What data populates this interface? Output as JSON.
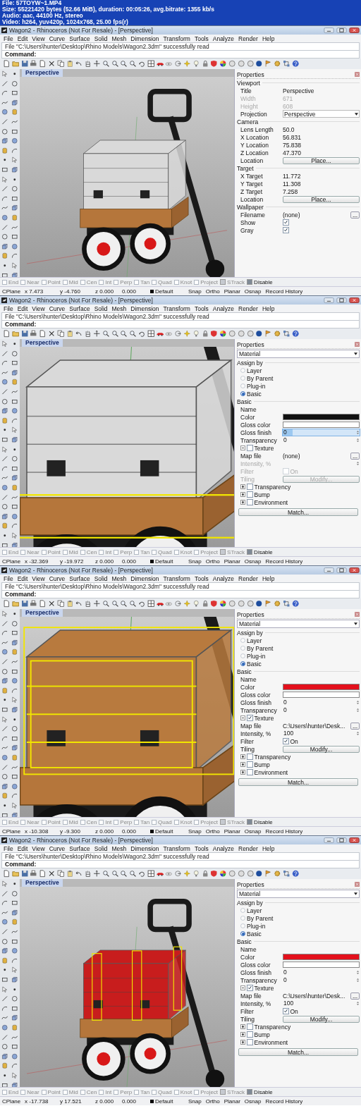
{
  "file_info": [
    "File: 57TOYW~1.MP4",
    "Size: 55221420 bytes (52.66 MiB), duration: 00:05:26, avg.bitrate: 1355 kb/s",
    "Audio: aac, 44100 Hz, stereo",
    "Video: h264, yuv420p, 1024x768, 25.00 fps(r)"
  ],
  "frames": [
    {
      "window_title": "Wagon2 - Rhinoceros (Not For Resale) - [Perspective]",
      "menu": [
        "File",
        "Edit",
        "View",
        "Curve",
        "Surface",
        "Solid",
        "Mesh",
        "Dimension",
        "Transform",
        "Tools",
        "Analyze",
        "Render",
        "Help"
      ],
      "history": "File \"C:\\Users\\hunter\\Desktop\\Rhino Models\\Wagon2.3dm\" successfully read",
      "command_label": "Command:",
      "viewport_title": "Perspective",
      "scene": {
        "kind": "overview"
      },
      "panel": {
        "title": "Properties",
        "sections": [
          {
            "heading": "Viewport",
            "rows": [
              {
                "kind": "field",
                "label": "Title",
                "value": "Perspective",
                "disabled": false
              },
              {
                "kind": "field",
                "label": "Width",
                "value": "671",
                "disabled": true
              },
              {
                "kind": "field",
                "label": "Height",
                "value": "608",
                "disabled": true
              },
              {
                "kind": "select",
                "label": "Projection",
                "value": "Perspective"
              }
            ]
          },
          {
            "heading": "Camera",
            "rows": [
              {
                "kind": "field",
                "label": "Lens Length",
                "value": "50.0",
                "disabled": false
              },
              {
                "kind": "field",
                "label": "X Location",
                "value": "56.831",
                "disabled": false
              },
              {
                "kind": "field",
                "label": "Y Location",
                "value": "75.838",
                "disabled": false
              },
              {
                "kind": "field",
                "label": "Z Location",
                "value": "47.370",
                "disabled": false
              },
              {
                "kind": "button",
                "label": "Location",
                "button": "Place...",
                "disabled": false
              }
            ]
          },
          {
            "heading": "Target",
            "rows": [
              {
                "kind": "field",
                "label": "X Target",
                "value": "11.772",
                "disabled": false
              },
              {
                "kind": "field",
                "label": "Y Target",
                "value": "11.308",
                "disabled": false
              },
              {
                "kind": "field",
                "label": "Z Target",
                "value": "7.258",
                "disabled": false
              },
              {
                "kind": "button",
                "label": "Location",
                "button": "Place...",
                "disabled": false
              }
            ]
          },
          {
            "heading": "Wallpaper",
            "rows": [
              {
                "kind": "browse",
                "label": "Filename",
                "value": "(none)",
                "button": "..."
              },
              {
                "kind": "check",
                "label": "Show",
                "checked": true,
                "disabled": false
              },
              {
                "kind": "check",
                "label": "Gray",
                "checked": true,
                "disabled": false
              }
            ]
          }
        ]
      },
      "osnaps": [
        {
          "kind": "check",
          "label": "End",
          "checked": false
        },
        {
          "kind": "check",
          "label": "Near",
          "checked": false
        },
        {
          "kind": "check",
          "label": "Point",
          "checked": false
        },
        {
          "kind": "check",
          "label": "Mid",
          "checked": false
        },
        {
          "kind": "check",
          "label": "Cen",
          "checked": false
        },
        {
          "kind": "check",
          "label": "Int",
          "checked": false
        },
        {
          "kind": "check",
          "label": "Perp",
          "checked": false
        },
        {
          "kind": "check",
          "label": "Tan",
          "checked": false
        },
        {
          "kind": "check",
          "label": "Quad",
          "checked": false
        },
        {
          "kind": "check",
          "label": "Knot",
          "checked": false
        },
        {
          "kind": "check",
          "label": "Project",
          "checked": false
        },
        {
          "kind": "toggle",
          "label": "STrack",
          "checked": false
        },
        {
          "kind": "toggle",
          "label": "Disable",
          "checked": true
        }
      ],
      "status": {
        "cplane": "CPlane",
        "x": "x 7.473",
        "y": "y -4.760",
        "z": "z 0.000",
        "value": "0.000",
        "layer": "Default",
        "panes": [
          "Snap",
          "Ortho",
          "Planar",
          "Osnap",
          "Record History"
        ]
      }
    },
    {
      "window_title": "Wagon2 - Rhinoceros (Not For Resale) - [Perspective]",
      "menu": [
        "File",
        "Edit",
        "View",
        "Curve",
        "Surface",
        "Solid",
        "Mesh",
        "Dimension",
        "Transform",
        "Tools",
        "Analyze",
        "Render",
        "Help"
      ],
      "history": "File \"C:\\Users\\hunter\\Desktop\\Rhino Models\\Wagon2.3dm\" successfully read",
      "command_label": "Command:",
      "viewport_title": "Perspective",
      "scene": {
        "kind": "base"
      },
      "panel": {
        "title": "Properties",
        "dropdown": "Material",
        "sections": [
          {
            "heading": "Assign by",
            "rows": [
              {
                "kind": "radio",
                "label": "Layer",
                "selected": false
              },
              {
                "kind": "radio",
                "label": "By Parent",
                "selected": false
              },
              {
                "kind": "radio",
                "label": "Plug-in",
                "selected": false
              },
              {
                "kind": "radio",
                "label": "Basic",
                "selected": true
              }
            ]
          },
          {
            "heading": "Basic",
            "rows": [
              {
                "kind": "field",
                "label": "Name",
                "disabled": false
              },
              {
                "kind": "swatch",
                "label": "Color",
                "color": "#111111"
              },
              {
                "kind": "swatch",
                "label": "Gloss color",
                "color": "#ffffff"
              },
              {
                "kind": "spin",
                "label": "Gloss finish",
                "value": "0",
                "disabled": false,
                "highlighted": true
              },
              {
                "kind": "spin",
                "label": "Transparency",
                "value": "0",
                "disabled": false,
                "highlighted": false
              },
              {
                "kind": "group",
                "label": "Texture",
                "checked": false,
                "expanded": true
              },
              {
                "kind": "browse",
                "label": "Map file",
                "value": "(none)",
                "button": "..."
              },
              {
                "kind": "spin",
                "label": "Intensity, %",
                "disabled": true,
                "highlighted": false
              },
              {
                "kind": "check",
                "label": "Filter",
                "text": "On",
                "checked": false,
                "disabled": true
              },
              {
                "kind": "button",
                "label": "Tiling",
                "button": "Modify...",
                "disabled": true
              },
              {
                "kind": "group",
                "label": "Transparency",
                "checked": false,
                "expanded": false
              },
              {
                "kind": "group",
                "label": "Bump",
                "checked": false,
                "expanded": false
              },
              {
                "kind": "group",
                "label": "Environment",
                "checked": false,
                "expanded": false
              }
            ]
          }
        ],
        "footer_button": "Match..."
      },
      "osnaps": [
        {
          "kind": "check",
          "label": "End",
          "checked": false
        },
        {
          "kind": "check",
          "label": "Near",
          "checked": false
        },
        {
          "kind": "check",
          "label": "Point",
          "checked": false
        },
        {
          "kind": "check",
          "label": "Mid",
          "checked": false
        },
        {
          "kind": "check",
          "label": "Cen",
          "checked": false
        },
        {
          "kind": "check",
          "label": "Int",
          "checked": false
        },
        {
          "kind": "check",
          "label": "Perp",
          "checked": false
        },
        {
          "kind": "check",
          "label": "Tan",
          "checked": false
        },
        {
          "kind": "check",
          "label": "Quad",
          "checked": false
        },
        {
          "kind": "check",
          "label": "Knot",
          "checked": false
        },
        {
          "kind": "check",
          "label": "Project",
          "checked": false
        },
        {
          "kind": "toggle",
          "label": "STrack",
          "checked": false
        },
        {
          "kind": "toggle",
          "label": "Disable",
          "checked": true
        }
      ],
      "status": {
        "cplane": "CPlane",
        "x": "x -32.369",
        "y": "y -19.972",
        "z": "z 0.000",
        "value": "0.000",
        "layer": "Default",
        "panes": [
          "Snap",
          "Ortho",
          "Planar",
          "Osnap",
          "Record History"
        ]
      }
    },
    {
      "window_title": "Wagon2 - Rhinoceros (Not For Resale) - [Perspective]",
      "menu": [
        "File",
        "Edit",
        "View",
        "Curve",
        "Surface",
        "Solid",
        "Mesh",
        "Dimension",
        "Transform",
        "Tools",
        "Analyze",
        "Render",
        "Help"
      ],
      "history": "File \"C:\\Users\\hunter\\Desktop\\Rhino Models\\Wagon2.3dm\" successfully read",
      "command_label": "Command:",
      "viewport_title": "Perspective",
      "scene": {
        "kind": "closeup"
      },
      "panel": {
        "title": "Properties",
        "dropdown": "Material",
        "sections": [
          {
            "heading": "Assign by",
            "rows": [
              {
                "kind": "radio",
                "label": "Layer",
                "selected": false
              },
              {
                "kind": "radio",
                "label": "By Parent",
                "selected": false
              },
              {
                "kind": "radio",
                "label": "Plug-in",
                "selected": false
              },
              {
                "kind": "radio",
                "label": "Basic",
                "selected": true
              }
            ]
          },
          {
            "heading": "Basic",
            "rows": [
              {
                "kind": "field",
                "label": "Name",
                "disabled": false
              },
              {
                "kind": "swatch",
                "label": "Color",
                "color": "#e3101c"
              },
              {
                "kind": "swatch",
                "label": "Gloss color",
                "color": "#ffffff"
              },
              {
                "kind": "spin",
                "label": "Gloss finish",
                "value": "0",
                "disabled": false,
                "highlighted": false
              },
              {
                "kind": "spin",
                "label": "Transparency",
                "value": "0",
                "disabled": false,
                "highlighted": false
              },
              {
                "kind": "group",
                "label": "Texture",
                "checked": true,
                "expanded": true
              },
              {
                "kind": "browse",
                "label": "Map file",
                "value": "C:\\Users\\hunter\\Desk...",
                "button": "..."
              },
              {
                "kind": "spin",
                "label": "Intensity, %",
                "value": "100",
                "disabled": false,
                "highlighted": false
              },
              {
                "kind": "check",
                "label": "Filter",
                "text": "On",
                "checked": true,
                "disabled": false
              },
              {
                "kind": "button",
                "label": "Tiling",
                "button": "Modify...",
                "disabled": false
              },
              {
                "kind": "group",
                "label": "Transparency",
                "checked": false,
                "expanded": false
              },
              {
                "kind": "group",
                "label": "Bump",
                "checked": false,
                "expanded": false
              },
              {
                "kind": "group",
                "label": "Environment",
                "checked": false,
                "expanded": false
              }
            ]
          }
        ],
        "footer_button": "Match..."
      },
      "osnaps": [
        {
          "kind": "check",
          "label": "End",
          "checked": false
        },
        {
          "kind": "check",
          "label": "Near",
          "checked": false
        },
        {
          "kind": "check",
          "label": "Point",
          "checked": false
        },
        {
          "kind": "check",
          "label": "Mid",
          "checked": false
        },
        {
          "kind": "check",
          "label": "Cen",
          "checked": false
        },
        {
          "kind": "check",
          "label": "Int",
          "checked": false
        },
        {
          "kind": "check",
          "label": "Perp",
          "checked": false
        },
        {
          "kind": "check",
          "label": "Tan",
          "checked": false
        },
        {
          "kind": "check",
          "label": "Quad",
          "checked": false
        },
        {
          "kind": "check",
          "label": "Knot",
          "checked": false
        },
        {
          "kind": "check",
          "label": "Project",
          "checked": false
        },
        {
          "kind": "toggle",
          "label": "STrack",
          "checked": false
        },
        {
          "kind": "toggle",
          "label": "Disable",
          "checked": true
        }
      ],
      "status": {
        "cplane": "CPlane",
        "x": "x -10.308",
        "y": "y -9.300",
        "z": "z 0.000",
        "value": "0.000",
        "layer": "Default",
        "panes": [
          "Snap",
          "Ortho",
          "Planar",
          "Osnap",
          "Record History"
        ]
      }
    },
    {
      "window_title": "Wagon2 - Rhinoceros (Not For Resale) - [Perspective]",
      "menu": [
        "File",
        "Edit",
        "View",
        "Curve",
        "Surface",
        "Solid",
        "Mesh",
        "Dimension",
        "Transform",
        "Tools",
        "Analyze",
        "Render",
        "Help"
      ],
      "history": "File \"C:\\Users\\hunter\\Desktop\\Rhino Models\\Wagon2.3dm\" successfully read",
      "command_label": "Command:",
      "viewport_title": "Perspective",
      "scene": {
        "kind": "posts"
      },
      "panel": {
        "title": "Properties",
        "dropdown": "Material",
        "sections": [
          {
            "heading": "Assign by",
            "rows": [
              {
                "kind": "radio",
                "label": "Layer",
                "selected": false
              },
              {
                "kind": "radio",
                "label": "By Parent",
                "selected": false
              },
              {
                "kind": "radio",
                "label": "Plug-in",
                "selected": false
              },
              {
                "kind": "radio",
                "label": "Basic",
                "selected": true
              }
            ]
          },
          {
            "heading": "Basic",
            "rows": [
              {
                "kind": "field",
                "label": "Name",
                "disabled": false
              },
              {
                "kind": "swatch",
                "label": "Color",
                "color": "#e3101c"
              },
              {
                "kind": "swatch",
                "label": "Gloss color",
                "color": "#ffffff"
              },
              {
                "kind": "spin",
                "label": "Gloss finish",
                "value": "0",
                "disabled": false,
                "highlighted": false
              },
              {
                "kind": "spin",
                "label": "Transparency",
                "value": "0",
                "disabled": false,
                "highlighted": false
              },
              {
                "kind": "group",
                "label": "Texture",
                "checked": true,
                "expanded": true
              },
              {
                "kind": "browse",
                "label": "Map file",
                "value": "C:\\Users\\hunter\\Desk...",
                "button": "..."
              },
              {
                "kind": "spin",
                "label": "Intensity, %",
                "value": "100",
                "disabled": false,
                "highlighted": false
              },
              {
                "kind": "check",
                "label": "Filter",
                "text": "On",
                "checked": true,
                "disabled": false
              },
              {
                "kind": "button",
                "label": "Tiling",
                "button": "Modify...",
                "disabled": false
              },
              {
                "kind": "group",
                "label": "Transparency",
                "checked": false,
                "expanded": false
              },
              {
                "kind": "group",
                "label": "Bump",
                "checked": false,
                "expanded": false
              },
              {
                "kind": "group",
                "label": "Environment",
                "checked": false,
                "expanded": false
              }
            ]
          }
        ],
        "footer_button": "Match..."
      },
      "osnaps": [
        {
          "kind": "check",
          "label": "End",
          "checked": false
        },
        {
          "kind": "check",
          "label": "Near",
          "checked": false
        },
        {
          "kind": "check",
          "label": "Point",
          "checked": false
        },
        {
          "kind": "check",
          "label": "Mid",
          "checked": false
        },
        {
          "kind": "check",
          "label": "Cen",
          "checked": false
        },
        {
          "kind": "check",
          "label": "Int",
          "checked": false
        },
        {
          "kind": "check",
          "label": "Perp",
          "checked": false
        },
        {
          "kind": "check",
          "label": "Tan",
          "checked": false
        },
        {
          "kind": "check",
          "label": "Quad",
          "checked": false
        },
        {
          "kind": "check",
          "label": "Knot",
          "checked": false
        },
        {
          "kind": "check",
          "label": "Project",
          "checked": false
        },
        {
          "kind": "toggle",
          "label": "STrack",
          "checked": false
        },
        {
          "kind": "toggle",
          "label": "Disable",
          "checked": true
        }
      ],
      "status": {
        "cplane": "CPlane",
        "x": "x -17.738",
        "y": "y 17.521",
        "z": "z 0.000",
        "value": "0.000",
        "layer": "Default",
        "panes": [
          "Snap",
          "Ortho",
          "Planar",
          "Osnap",
          "Record History"
        ]
      }
    }
  ]
}
